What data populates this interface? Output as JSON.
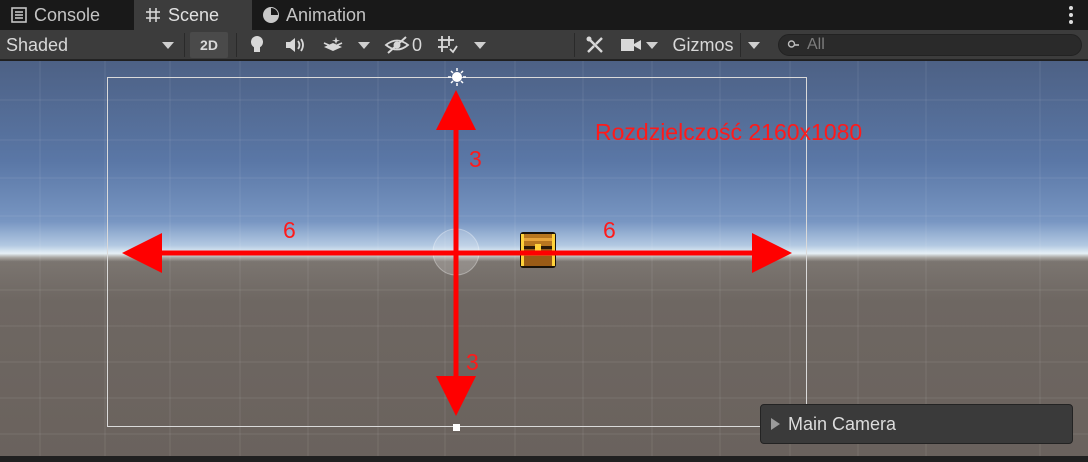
{
  "tabs": [
    {
      "label": "Console",
      "icon": "console-icon"
    },
    {
      "label": "Scene",
      "icon": "scene-grid-icon",
      "active": true
    },
    {
      "label": "Animation",
      "icon": "animation-clock-icon"
    }
  ],
  "toolbar": {
    "draw_mode": "Shaded",
    "toggle_2d": "2D",
    "hidden_count": "0",
    "gizmos_label": "Gizmos",
    "search_placeholder": "All"
  },
  "scene": {
    "resolution_label": "Rozdzielczość 2160x1080",
    "half_width_left": "6",
    "half_width_right": "6",
    "half_height_top": "3",
    "half_height_bottom": "3",
    "annotation_color": "#ff1a1a",
    "camera_frame_color": "#d9d9d9"
  },
  "camera_overlay": {
    "title": "Main Camera"
  }
}
